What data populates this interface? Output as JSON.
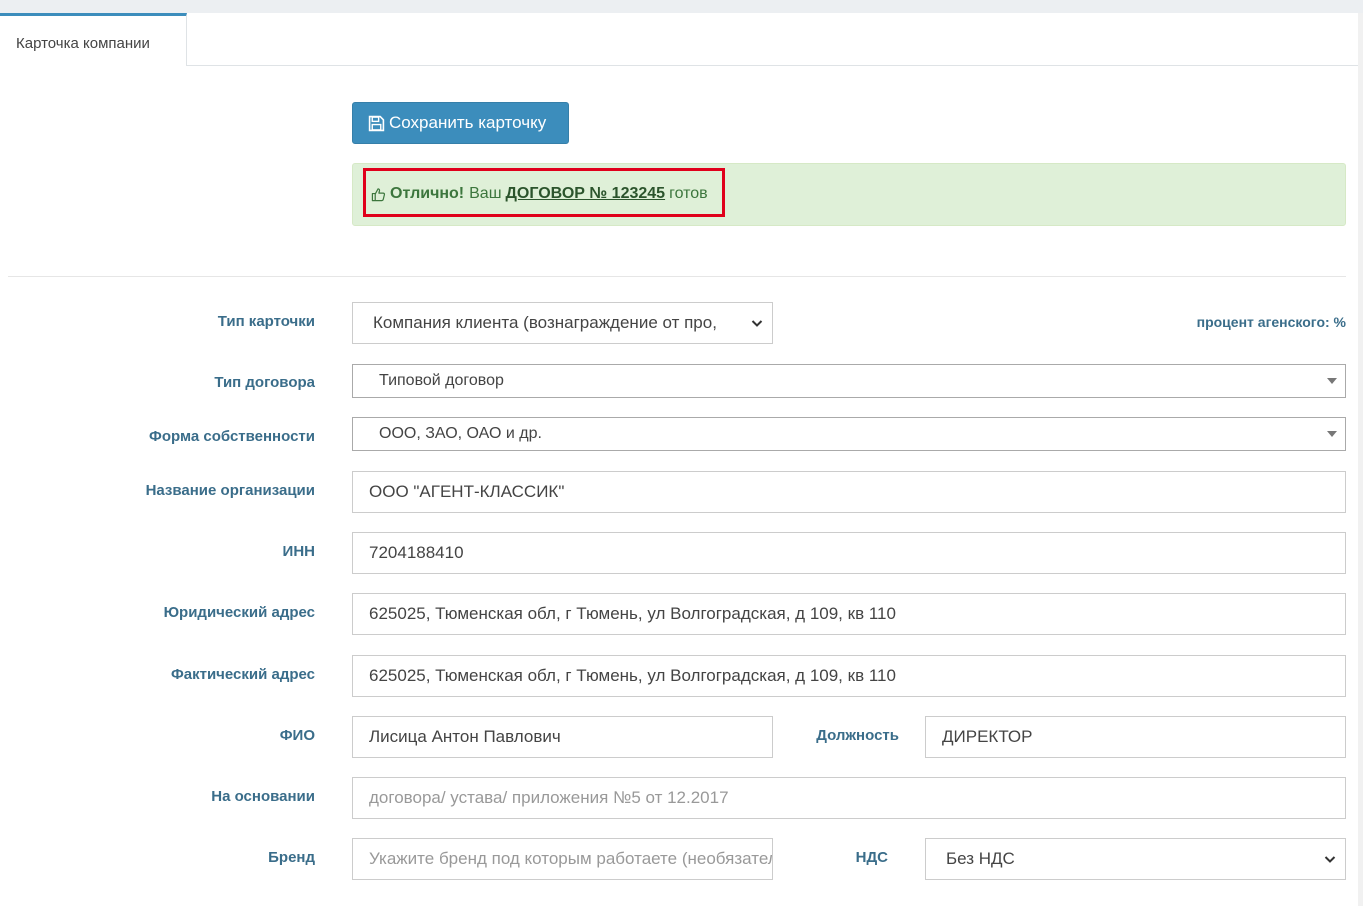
{
  "tabs": [
    {
      "label": "Карточка компании",
      "active": true
    }
  ],
  "toolbar": {
    "save_label": "Сохранить карточку",
    "save_icon": "floppy-disk-icon"
  },
  "alert": {
    "icon": "thumbs-up-icon",
    "strong": "Отлично!",
    "prefix": "Ваш",
    "link": "ДОГОВОР № 123245",
    "suffix": "готов"
  },
  "form": {
    "card_type": {
      "label": "Тип карточки",
      "value": "Компания клиента (вознаграждение от про,"
    },
    "agency_percent": {
      "label": "процент агенского: %"
    },
    "contract_type": {
      "label": "Тип договора",
      "value": "Типовой договор"
    },
    "ownership": {
      "label": "Форма собственности",
      "value": "ООО, ЗАО, ОАО и др."
    },
    "org_name": {
      "label": "Название организации",
      "value": "ООО \"АГЕНТ-КЛАССИК\""
    },
    "inn": {
      "label": "ИНН",
      "value": "7204188410"
    },
    "legal_address": {
      "label": "Юридический адрес",
      "value": "625025, Тюменская обл, г Тюмень, ул Волгоградская, д 109, кв 110"
    },
    "actual_address": {
      "label": "Фактический адрес",
      "value": "625025, Тюменская обл, г Тюмень, ул Волгоградская, д 109, кв 110"
    },
    "fio": {
      "label": "ФИО",
      "value": "Лисица Антон Павлович"
    },
    "position": {
      "label": "Должность",
      "value": "ДИРЕКТОР"
    },
    "basis": {
      "label": "На основании",
      "placeholder": "договора/ устава/ приложения №5 от 12.2017"
    },
    "brand": {
      "label": "Бренд",
      "placeholder": "Укажите бренд под которым работаете (необязательно)"
    },
    "vat": {
      "label": "НДС",
      "value": "Без НДС"
    }
  },
  "colors": {
    "primary": "#3c8dbc",
    "alert_bg": "#dff0d8",
    "alert_text": "#3c763d",
    "label": "#3a6d8a",
    "highlight": "#e0001b"
  }
}
